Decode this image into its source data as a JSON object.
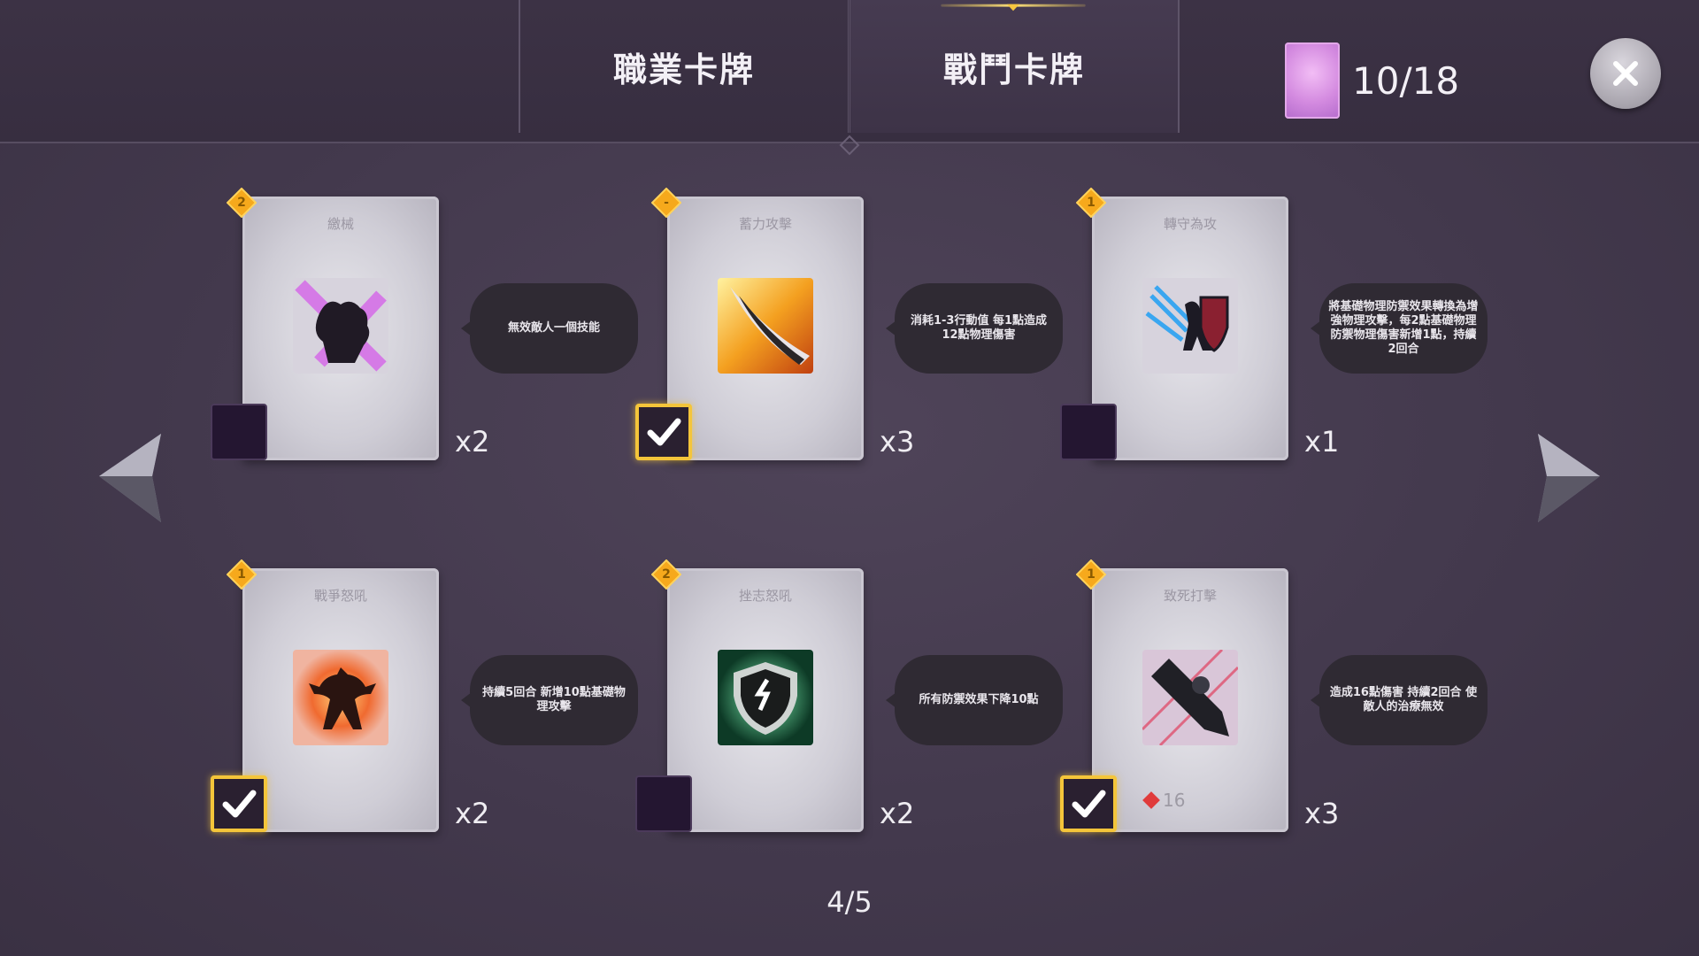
{
  "tabs": {
    "class_cards": "職業卡牌",
    "battle_cards": "戰鬥卡牌"
  },
  "counter": {
    "text": "10/18"
  },
  "cards": [
    {
      "cost": "2",
      "title": "繳械",
      "desc": "無效敵人一個技能",
      "qty": "x2",
      "selected": false,
      "art": "fist-icon"
    },
    {
      "cost": "-",
      "title": "蓄力攻擊",
      "desc": "消耗1-3行動值 每1點造成12點物理傷害",
      "qty": "x3",
      "selected": true,
      "art": "blade-icon"
    },
    {
      "cost": "1",
      "title": "轉守為攻",
      "desc": "將基礎物理防禦效果轉換為增強物理攻擊，每2點基礎物理防禦物理傷害新增1點，持續2回合",
      "qty": "x1",
      "selected": false,
      "art": "shield-warrior-icon"
    },
    {
      "cost": "1",
      "title": "戰爭怒吼",
      "desc": "持續5回合 新增10點基礎物理攻擊",
      "qty": "x2",
      "selected": true,
      "art": "roar-icon"
    },
    {
      "cost": "2",
      "title": "挫志怒吼",
      "desc": "所有防禦效果下降10點",
      "qty": "x2",
      "selected": false,
      "art": "cracked-shield-icon"
    },
    {
      "cost": "1",
      "title": "致死打擊",
      "desc": "造成16點傷害 持續2回合 使敵人的治療無效",
      "qty": "x3",
      "selected": true,
      "art": "dagger-icon",
      "attack": "16"
    }
  ],
  "page": {
    "indicator": "4/5"
  },
  "colors": {
    "background": "#43394d",
    "accent_gold": "#f4c53a",
    "card_silver": "#d9d7df",
    "bubble": "#2f2a33"
  }
}
